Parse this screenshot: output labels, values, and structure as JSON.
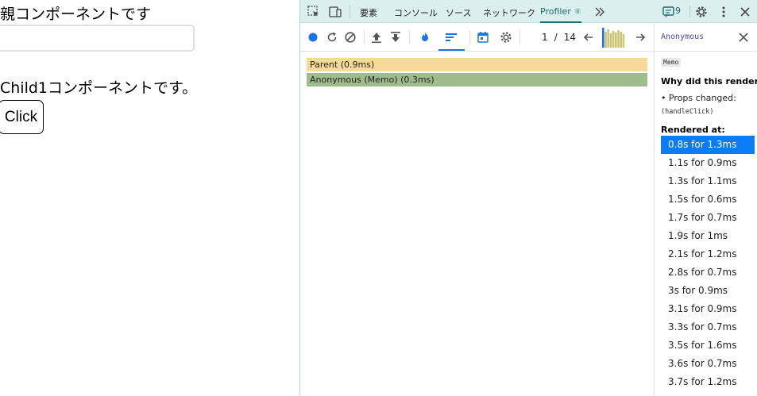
{
  "page": {
    "title": "親コンポーネントです",
    "input_value": "",
    "child_text": "Child1コンポーネントです。",
    "button_label": "Click"
  },
  "devtools": {
    "tabs": [
      "要素",
      "コンソール",
      "ソース",
      "ネットワーク",
      "Profiler ⚛"
    ],
    "active_tab": "Profiler ⚛",
    "issues_count": "9",
    "colors": {
      "accent": "#1a73e8",
      "tab_active": "#1a6b6a",
      "selected": "#0b7cf4",
      "parent_bar": "#f7d999",
      "memo_bar": "#9fbd8b"
    },
    "toolbar": {
      "icons": [
        "record-icon",
        "reload-icon",
        "clear-icon",
        "upload-icon",
        "download-icon",
        "flamegraph-icon",
        "ranked-icon",
        "timeline-icon",
        "settings-icon"
      ],
      "commit_current": "1",
      "commit_separator": "/",
      "commit_total": "14"
    },
    "flamegraph": {
      "bars": [
        {
          "label": "Parent (0.9ms)"
        },
        {
          "label": "Anonymous (Memo) (0.3ms)"
        }
      ]
    },
    "sidebar": {
      "component_name": "Anonymous",
      "memo_tag": "Memo",
      "why_heading": "Why did this render?",
      "props_changed": "• Props changed:",
      "changed_prop": "(handleClick)",
      "rendered_heading": "Rendered at:",
      "renders": [
        "0.8s for 1.3ms",
        "1.1s for 0.9ms",
        "1.3s for 1.1ms",
        "1.5s for 0.6ms",
        "1.7s for 0.7ms",
        "1.9s for 1ms",
        "2.1s for 1.2ms",
        "2.8s for 0.7ms",
        "3s for 0.9ms",
        "3.1s for 0.9ms",
        "3.3s for 0.7ms",
        "3.5s for 1.6ms",
        "3.6s for 0.7ms",
        "3.7s for 1.2ms"
      ]
    }
  }
}
